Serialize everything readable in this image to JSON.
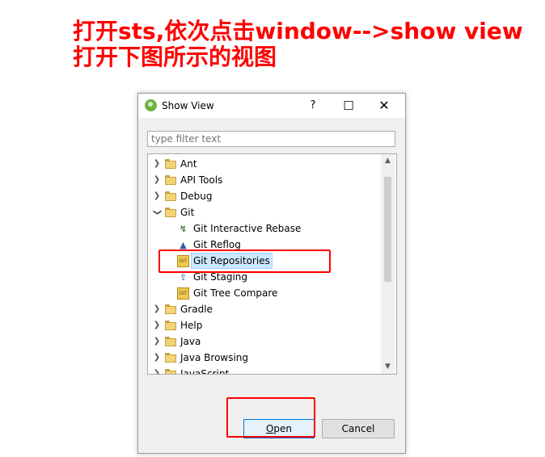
{
  "annotation": {
    "line1": "打开sts,依次点击window-->show view",
    "line2": "打开下图所示的视图"
  },
  "dialog": {
    "title": "Show View",
    "help_glyph": "?",
    "maximize_glyph": "☐",
    "close_glyph": "✕",
    "filter_placeholder": "type filter text",
    "tree": [
      {
        "label": "Ant",
        "expanded": false
      },
      {
        "label": "API Tools",
        "expanded": false
      },
      {
        "label": "Debug",
        "expanded": false
      },
      {
        "label": "Git",
        "expanded": true,
        "children": [
          {
            "label": "Git Interactive Rebase",
            "icon": "interactive-rebase-icon"
          },
          {
            "label": "Git Reflog",
            "icon": "reflog-icon"
          },
          {
            "label": "Git Repositories",
            "icon": "git-repositories-icon",
            "selected": true
          },
          {
            "label": "Git Staging",
            "icon": "git-staging-icon"
          },
          {
            "label": "Git Tree Compare",
            "icon": "git-tree-compare-icon"
          }
        ]
      },
      {
        "label": "Gradle",
        "expanded": false
      },
      {
        "label": "Help",
        "expanded": false
      },
      {
        "label": "Java",
        "expanded": false
      },
      {
        "label": "Java Browsing",
        "expanded": false
      },
      {
        "label": "JavaScript",
        "expanded": false
      }
    ],
    "buttons": {
      "open": "Open",
      "open_mnemonic": "O",
      "open_rest": "pen",
      "cancel": "Cancel"
    }
  },
  "colors": {
    "annotation": "#ff0000",
    "selection": "#cce8ff",
    "default_button_border": "#0078d7"
  }
}
